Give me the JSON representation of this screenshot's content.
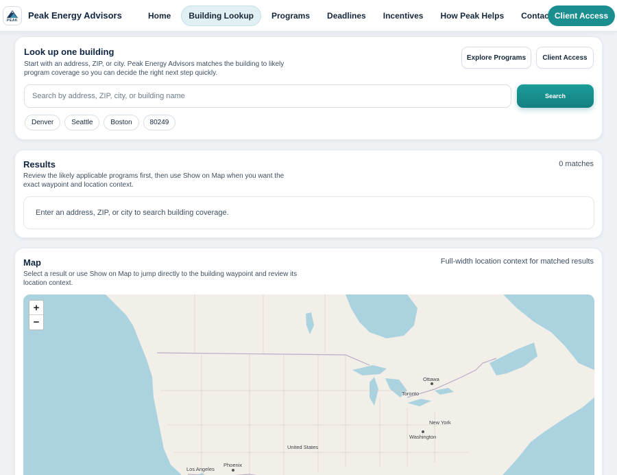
{
  "header": {
    "logo_text": "PEAK",
    "brand": "Peak Energy Advisors",
    "nav": [
      {
        "label": "Home",
        "active": false
      },
      {
        "label": "Building Lookup",
        "active": true
      },
      {
        "label": "Programs",
        "active": false
      },
      {
        "label": "Deadlines",
        "active": false
      },
      {
        "label": "Incentives",
        "active": false
      },
      {
        "label": "How Peak Helps",
        "active": false
      },
      {
        "label": "Contact",
        "active": false
      }
    ],
    "cta_label": "Client Access"
  },
  "lookup": {
    "title": "Look up one building",
    "description": "Start with an address, ZIP, or city. Peak Energy Advisors matches the building to likely program coverage so you can decide the right next step quickly.",
    "explore_label": "Explore Programs",
    "client_access_label": "Client Access",
    "search_placeholder": "Search by address, ZIP, city, or building name",
    "search_value": "",
    "search_button": "Search",
    "chips": [
      "Denver",
      "Seattle",
      "Boston",
      "80249"
    ]
  },
  "results": {
    "title": "Results",
    "description": "Review the likely applicable programs first, then use Show on Map when you want the exact waypoint and location context.",
    "count": "0 matches",
    "empty_message": "Enter an address, ZIP, or city to search building coverage."
  },
  "map": {
    "title": "Map",
    "description": "Select a result or use Show on Map to jump directly to the building waypoint and review its location context.",
    "context_label": "Full-width location context for matched results",
    "zoom_in": "+",
    "zoom_out": "−",
    "labels": {
      "ottawa": "Ottawa",
      "toronto": "Toronto",
      "new_york": "New York",
      "washington": "Washington",
      "united_states": "United States",
      "phoenix": "Phoenix",
      "los_angeles": "Los Angeles"
    },
    "colors": {
      "water": "#aad3df",
      "land": "#f2efe9",
      "border": "#b8aec6"
    }
  }
}
